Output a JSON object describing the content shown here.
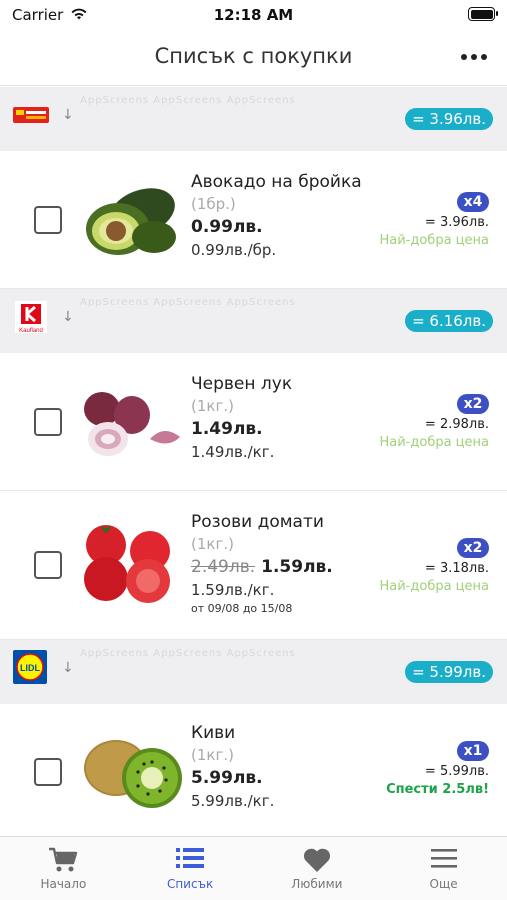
{
  "status_bar": {
    "carrier": "Carrier",
    "time": "12:18 AM"
  },
  "nav": {
    "title": "Списък с покупки"
  },
  "colors": {
    "accent": "#3c50c4",
    "total_badge": "#1aaec8",
    "best_price": "#9fd07a",
    "savings": "#1ea34a",
    "tab_active": "#3e5ed8"
  },
  "stores": [
    {
      "name": "BILLA",
      "logo_text": "MARKET",
      "total": "= 3.96лв.",
      "products": [
        {
          "name": "Авокадо на бройка",
          "unit": "(1бр.)",
          "price": "0.99лв.",
          "per_unit": "0.99лв./бр.",
          "qty": "x4",
          "total": "= 3.96лв.",
          "tag": "Най-добра цена",
          "image": "avocado"
        }
      ]
    },
    {
      "name": "Kaufland",
      "logo_text": "Kaufland",
      "total": "= 6.16лв.",
      "products": [
        {
          "name": "Червен лук",
          "unit": "(1кг.)",
          "price": "1.49лв.",
          "per_unit": "1.49лв./кг.",
          "qty": "x2",
          "total": "= 2.98лв.",
          "tag": "Най-добра цена",
          "image": "red-onion"
        },
        {
          "name": "Розови домати",
          "unit": "(1кг.)",
          "old_price": "2.49лв.",
          "price": "1.59лв.",
          "per_unit": "1.59лв./кг.",
          "promo": "от 09/08 до 15/08",
          "qty": "x2",
          "total": "= 3.18лв.",
          "tag": "Най-добра цена",
          "image": "tomatoes"
        }
      ]
    },
    {
      "name": "Lidl",
      "logo_text": "LIDL",
      "total": "= 5.99лв.",
      "products": [
        {
          "name": "Киви",
          "unit": "(1кг.)",
          "price": "5.99лв.",
          "per_unit": "5.99лв./кг.",
          "qty": "x1",
          "total": "= 5.99лв.",
          "tag": "Спести 2.5лв!",
          "image": "kiwi"
        }
      ]
    }
  ],
  "watermark": "AppScreens  AppScreens  AppScreens",
  "tabs": [
    {
      "label": "Начало",
      "icon": "cart-icon",
      "active": false
    },
    {
      "label": "Списък",
      "icon": "list-icon",
      "active": true
    },
    {
      "label": "Любими",
      "icon": "heart-icon",
      "active": false
    },
    {
      "label": "Още",
      "icon": "menu-icon",
      "active": false
    }
  ]
}
